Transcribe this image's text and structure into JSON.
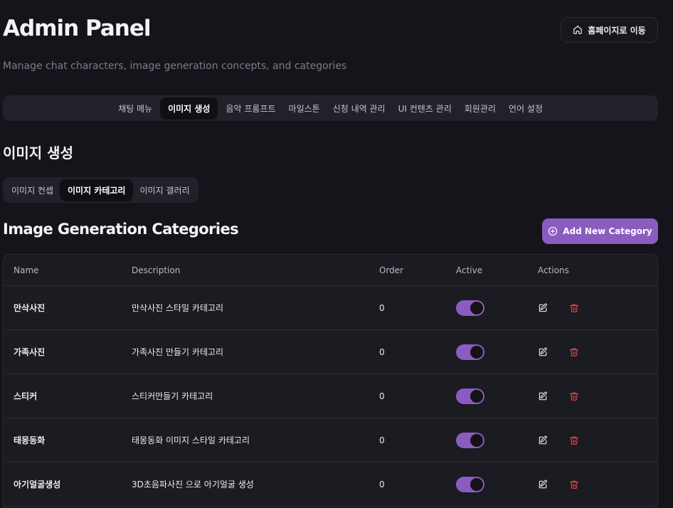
{
  "header": {
    "title": "Admin Panel",
    "subtitle": "Manage chat characters, image generation concepts, and categories",
    "home_button": "홈페이지로 이동"
  },
  "main_tabs": [
    "채팅 메뉴",
    "이미지 생성",
    "음악 프롬프트",
    "마일스톤",
    "신청 내역 관리",
    "UI 컨텐츠 관리",
    "회원관리",
    "언어 설정"
  ],
  "main_tab_active": "이미지 생성",
  "section": {
    "title": "이미지 생성"
  },
  "sub_tabs": [
    "이미지 컨셉",
    "이미지 카테고리",
    "이미지 갤러리"
  ],
  "sub_tab_active": "이미지 카테고리",
  "categories": {
    "title": "Image Generation Categories",
    "add_button": "Add New Category",
    "columns": {
      "name": "Name",
      "description": "Description",
      "order": "Order",
      "active": "Active",
      "actions": "Actions"
    },
    "rows": [
      {
        "name": "만삭사진",
        "description": "만삭사진 스타일 카테고리",
        "order": "0",
        "active": true
      },
      {
        "name": "가족사진",
        "description": "가족사진 만들기 카테고리",
        "order": "0",
        "active": true
      },
      {
        "name": "스티커",
        "description": "스티커만들기 카테고리",
        "order": "0",
        "active": true
      },
      {
        "name": "태몽동화",
        "description": "태몽동화 이미지 스타일 카테고리",
        "order": "0",
        "active": true
      },
      {
        "name": "아기얼굴생성",
        "description": "3D초음파사진 으로 아기얼굴 생성",
        "order": "0",
        "active": true
      }
    ]
  },
  "colors": {
    "accent": "#8b5cbf",
    "delete": "#e04848",
    "background": "#14141a"
  },
  "icons": {
    "home": "home-icon",
    "add": "plus-circle-icon",
    "edit": "edit-icon",
    "delete": "trash-icon"
  }
}
